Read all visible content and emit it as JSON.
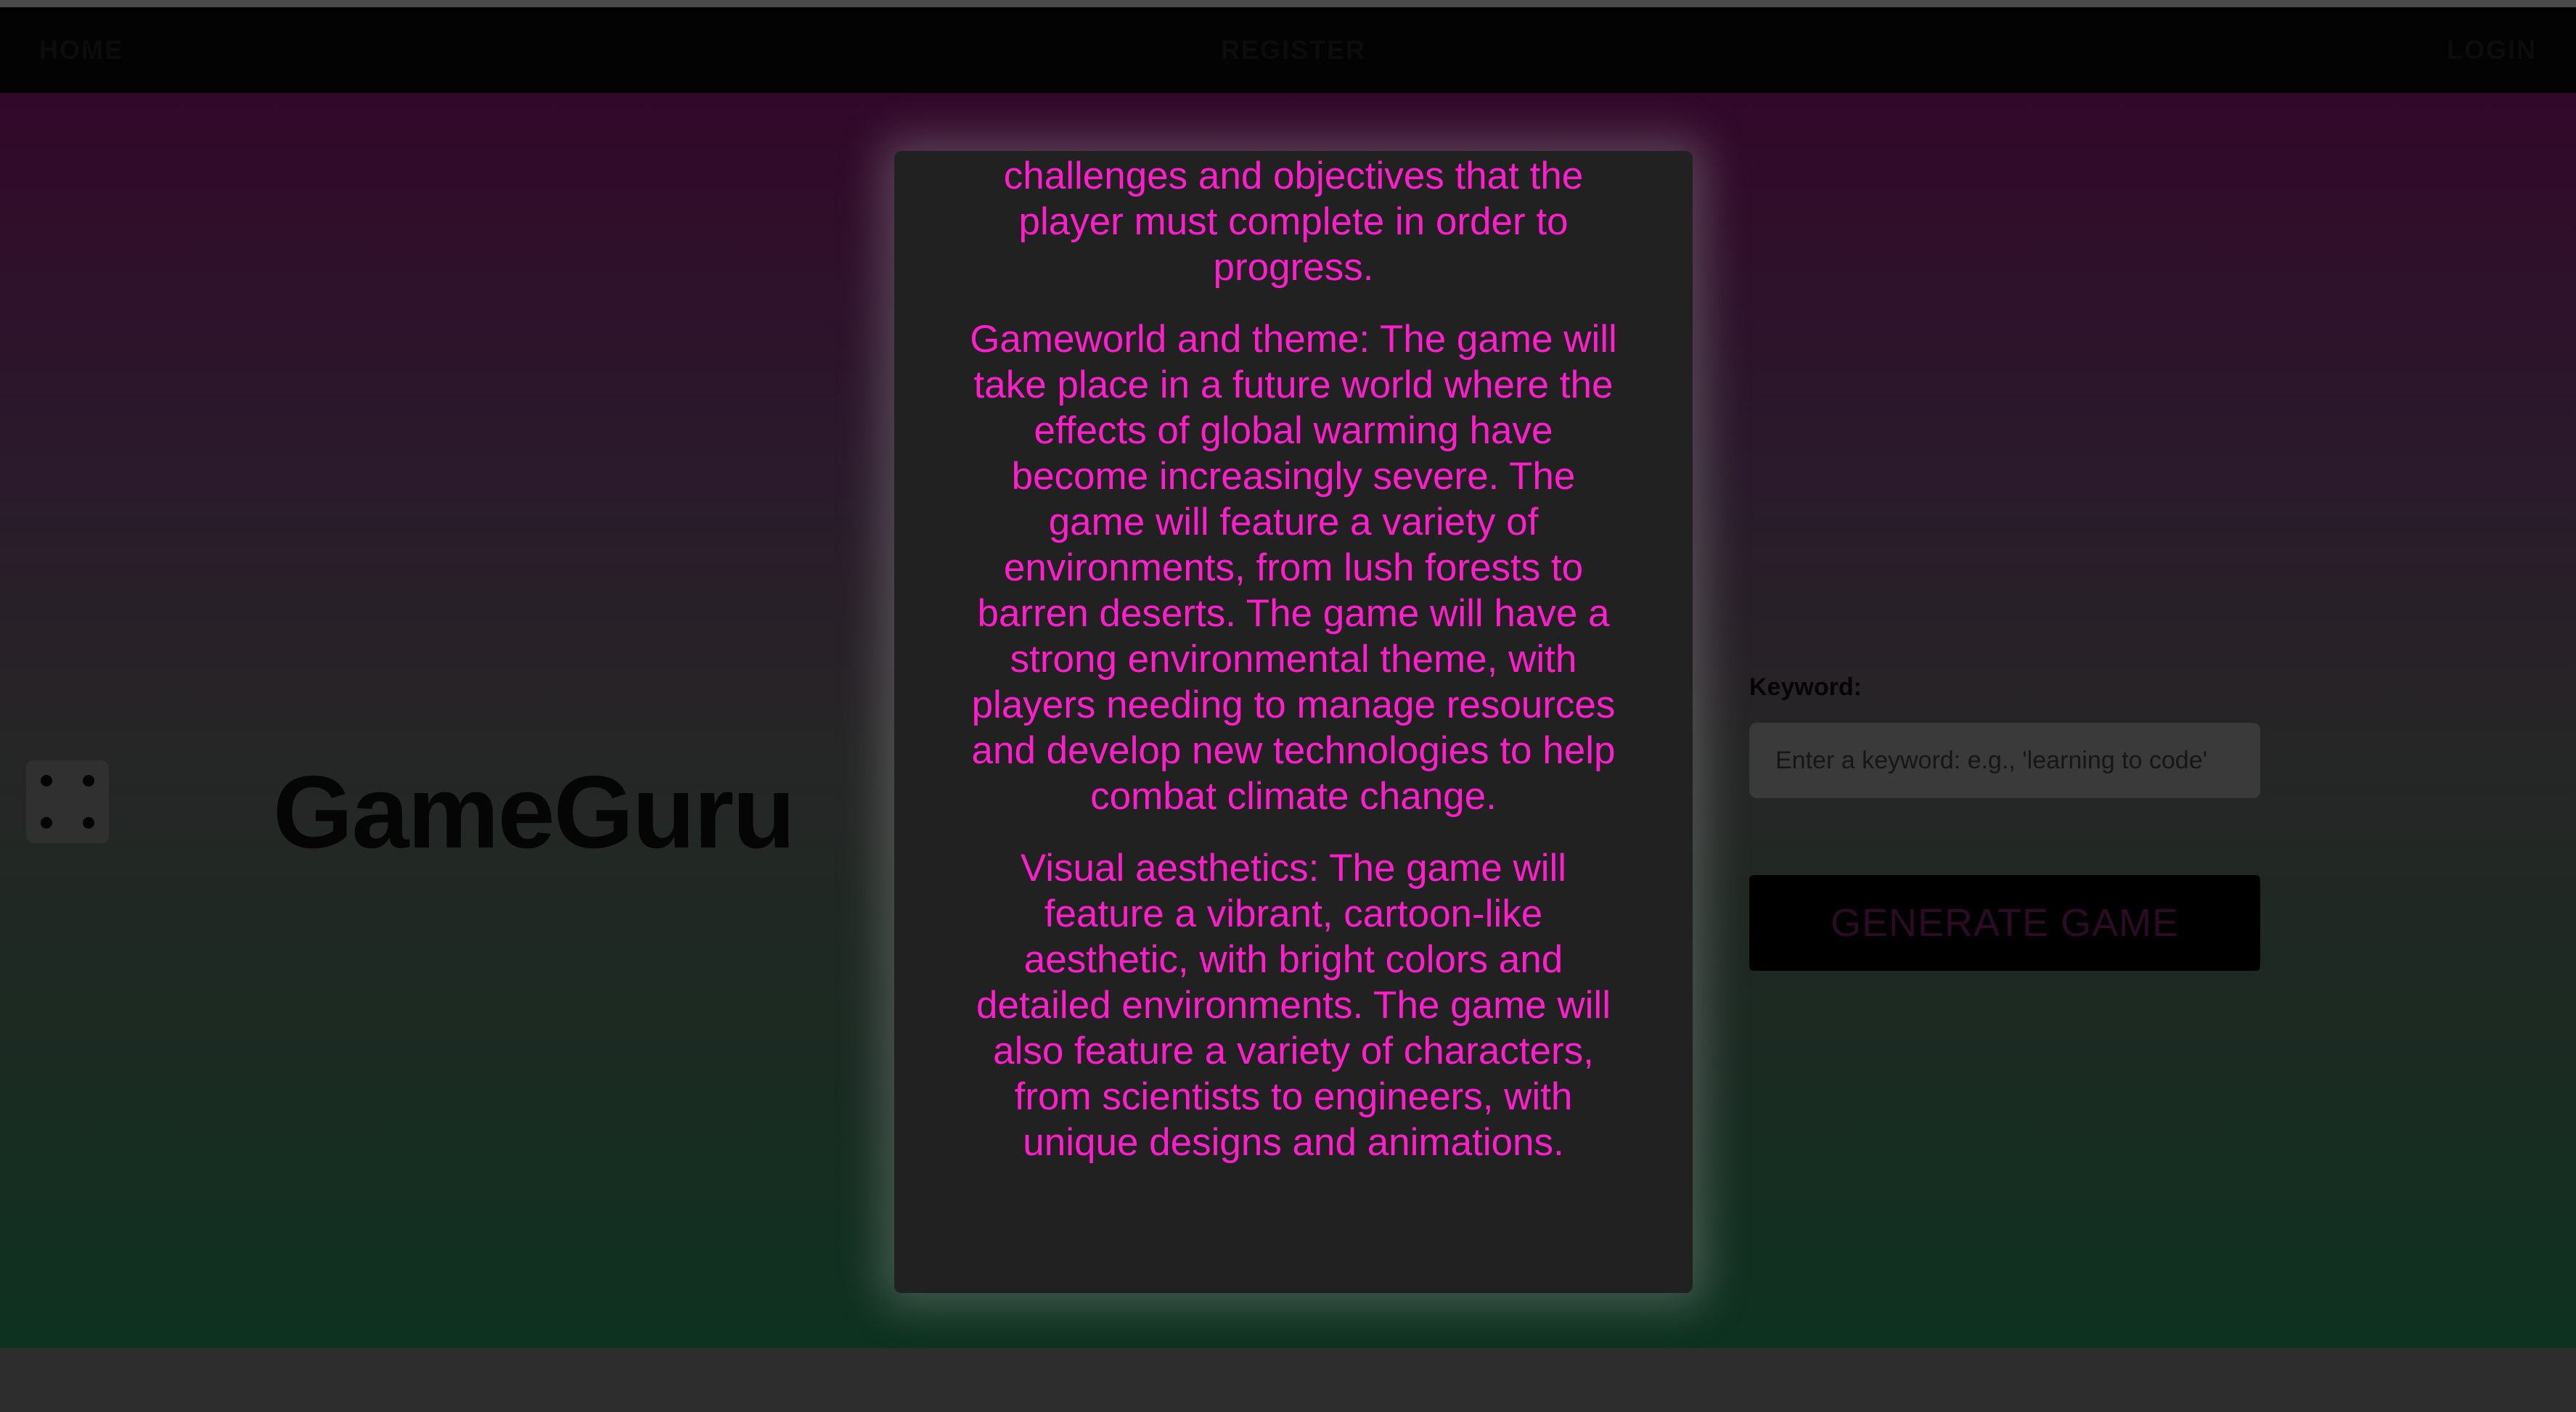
{
  "nav": {
    "home": "HOME",
    "register": "REGISTER",
    "login": "LOGIN"
  },
  "brand": {
    "title": "GameGuru"
  },
  "form": {
    "keyword_label": "Keyword:",
    "keyword_placeholder": "Enter a keyword: e.g., 'learning to code'",
    "keyword_value": "",
    "generate_label": "GENERATE GAME"
  },
  "modal": {
    "paragraphs": [
      "level will have its own unique challenges and objectives that the player must complete in order to progress.",
      "Gameworld and theme: The game will take place in a future world where the effects of global warming have become increasingly severe. The game will feature a variety of environments, from lush forests to barren deserts. The game will have a strong environmental theme, with players needing to manage resources and develop new technologies to help combat climate change.",
      "Visual aesthetics: The game will feature a vibrant, cartoon-like aesthetic, with bright colors and detailed environments. The game will also feature a variety of characters, from scientists to engineers, with unique designs and animations."
    ]
  },
  "icons": {
    "dice": "dice-icon"
  },
  "colors": {
    "modal_text": "#ff1ecb",
    "modal_background": "#212121",
    "navbar": "#030303",
    "gradient_top": "#32082a",
    "gradient_bottom": "#0e3220",
    "generate_text": "#2c0b25"
  }
}
